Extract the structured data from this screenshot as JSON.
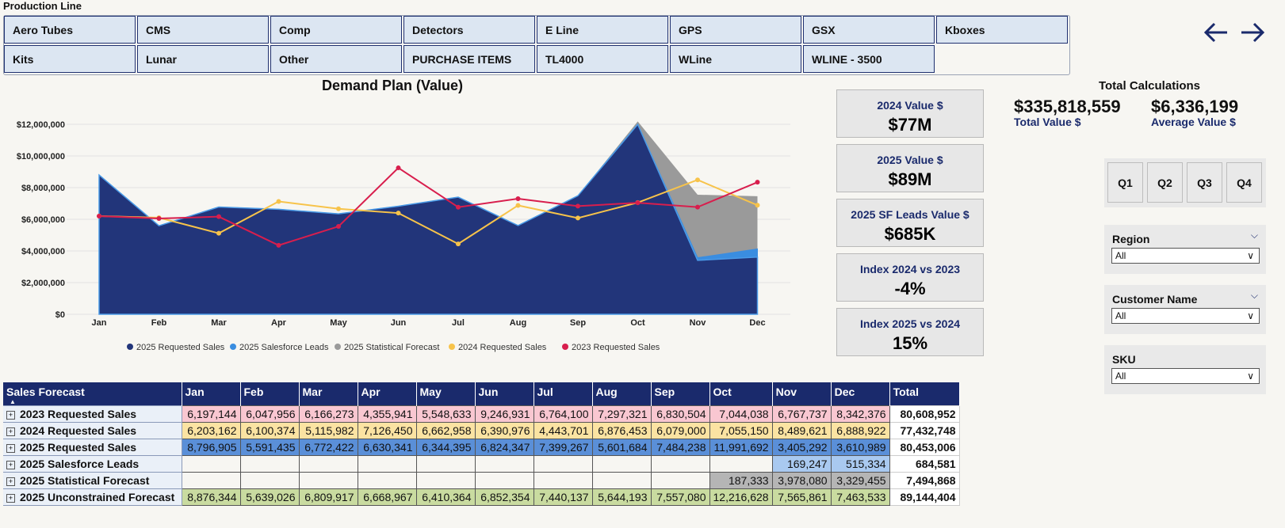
{
  "header": {
    "title": "Production Line",
    "tiles": [
      "Aero Tubes",
      "CMS",
      "Comp",
      "Detectors",
      "E Line",
      "GPS",
      "GSX",
      "Kboxes",
      "Kits",
      "Lunar",
      "Other",
      "PURCHASE ITEMS",
      "TL4000",
      "WLine",
      "WLINE - 3500"
    ]
  },
  "nav": {
    "back_icon": "arrow-left-icon",
    "forward_icon": "arrow-right-icon"
  },
  "chart": {
    "title": "Demand Plan (Value)",
    "colors": {
      "requested_2025": "#22357a",
      "sf_leads_2025": "#3a8de0",
      "stat_forecast_2025": "#9a9a9a",
      "requested_2024": "#f7c34a",
      "requested_2023": "#d81e4d"
    }
  },
  "chart_data": {
    "type": "area",
    "title": "Demand Plan (Value)",
    "xlabel": "",
    "ylabel": "",
    "categories": [
      "Jan",
      "Feb",
      "Mar",
      "Apr",
      "May",
      "Jun",
      "Jul",
      "Aug",
      "Sep",
      "Oct",
      "Nov",
      "Dec"
    ],
    "ylim": [
      0,
      12000000
    ],
    "yticks": [
      "$0",
      "$2,000,000",
      "$4,000,000",
      "$6,000,000",
      "$8,000,000",
      "$10,000,000",
      "$12,000,000"
    ],
    "grid": true,
    "legend_position": "bottom",
    "series": [
      {
        "name": "2025 Requested Sales",
        "kind": "area",
        "values": [
          8796905,
          5591435,
          6772422,
          6630341,
          6344395,
          6824347,
          7399267,
          5601684,
          7484238,
          11991692,
          3405292,
          3610989
        ]
      },
      {
        "name": "2025 Salesforce Leads",
        "kind": "area",
        "values": [
          0,
          0,
          0,
          0,
          0,
          0,
          0,
          0,
          0,
          0,
          169247,
          515334
        ]
      },
      {
        "name": "2025 Statistical Forecast",
        "kind": "area",
        "values": [
          0,
          0,
          0,
          0,
          0,
          0,
          0,
          0,
          0,
          187333,
          3978080,
          3329455
        ]
      },
      {
        "name": "2024 Requested Sales",
        "kind": "line",
        "values": [
          6203162,
          6100374,
          5115982,
          7126450,
          6662958,
          6390976,
          4443701,
          6876453,
          6079000,
          7055150,
          8489621,
          6888922
        ]
      },
      {
        "name": "2023 Requested Sales",
        "kind": "line",
        "values": [
          6197144,
          6047956,
          6166273,
          4355941,
          5548633,
          9246931,
          6764100,
          7297321,
          6830504,
          7044038,
          6767737,
          8342376
        ]
      }
    ]
  },
  "kpis": [
    {
      "label": "2024 Value $",
      "value": "$77M"
    },
    {
      "label": "2025 Value $",
      "value": "$89M"
    },
    {
      "label": "2025 SF Leads Value $",
      "value": "$685K"
    },
    {
      "label": "Index 2024 vs 2023",
      "value": "-4%"
    },
    {
      "label": "Index 2025 vs 2024",
      "value": "15%"
    }
  ],
  "totals": {
    "title": "Total Calculations",
    "total_value": "$335,818,559",
    "total_label": "Total Value $",
    "average_value": "$6,336,199",
    "average_label": "Average Value $"
  },
  "quarters": [
    "Q1",
    "Q2",
    "Q3",
    "Q4"
  ],
  "filters": [
    {
      "title": "Region",
      "value": "All"
    },
    {
      "title": "Customer Name",
      "value": "All"
    },
    {
      "title": "SKU",
      "value": "All"
    }
  ],
  "table": {
    "corner": "Sales Forecast",
    "sort_icon": "sort-ascending-icon",
    "columns": [
      "Jan",
      "Feb",
      "Mar",
      "Apr",
      "May",
      "Jun",
      "Jul",
      "Aug",
      "Sep",
      "Oct",
      "Nov",
      "Dec",
      "Total"
    ],
    "rows": [
      {
        "label": "2023 Requested Sales",
        "fill": "#f9c7d1",
        "cells": [
          "6,197,144",
          "6,047,956",
          "6,166,273",
          "4,355,941",
          "5,548,633",
          "9,246,931",
          "6,764,100",
          "7,297,321",
          "6,830,504",
          "7,044,038",
          "6,767,737",
          "8,342,376"
        ],
        "total": "80,608,952"
      },
      {
        "label": "2024 Requested Sales",
        "fill": "#fbe3a2",
        "cells": [
          "6,203,162",
          "6,100,374",
          "5,115,982",
          "7,126,450",
          "6,662,958",
          "6,390,976",
          "4,443,701",
          "6,876,453",
          "6,079,000",
          "7,055,150",
          "8,489,621",
          "6,888,922"
        ],
        "total": "77,432,748"
      },
      {
        "label": "2025 Requested Sales",
        "fill": "#5a8fd8",
        "cells": [
          "8,796,905",
          "5,591,435",
          "6,772,422",
          "6,630,341",
          "6,344,395",
          "6,824,347",
          "7,399,267",
          "5,601,684",
          "7,484,238",
          "11,991,692",
          "3,405,292",
          "3,610,989"
        ],
        "total": "80,453,006"
      },
      {
        "label": "2025 Salesforce Leads",
        "fill": "#a9c9f0",
        "cells": [
          "",
          "",
          "",
          "",
          "",
          "",
          "",
          "",
          "",
          "",
          "169,247",
          "515,334"
        ],
        "total": "684,581"
      },
      {
        "label": "2025 Statistical Forecast",
        "fill": "#b5b5b5",
        "cells": [
          "",
          "",
          "",
          "",
          "",
          "",
          "",
          "",
          "",
          "187,333",
          "3,978,080",
          "3,329,455"
        ],
        "total": "7,494,868"
      },
      {
        "label": "2025 Unconstrained Forecast",
        "fill": "#c9dba0",
        "cells": [
          "8,876,344",
          "5,639,026",
          "6,809,917",
          "6,668,967",
          "6,410,364",
          "6,852,354",
          "7,440,137",
          "5,644,193",
          "7,557,080",
          "12,216,628",
          "7,565,861",
          "7,463,533"
        ],
        "total": "89,144,404"
      }
    ]
  }
}
